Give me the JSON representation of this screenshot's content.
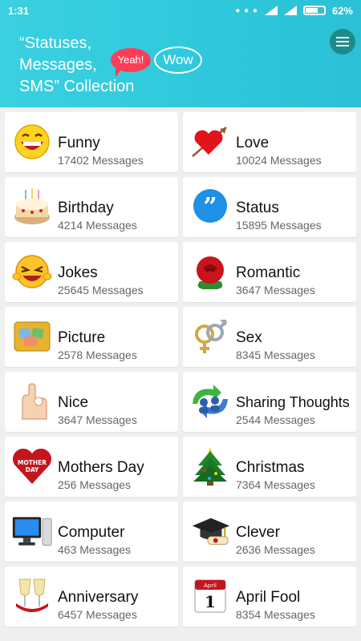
{
  "status_bar": {
    "time": "1:31",
    "battery": "62%"
  },
  "header": {
    "title_lines": [
      "“Statuses,",
      "Messages,",
      "SMS” Collection"
    ],
    "bubble_yeah": "Yeah!",
    "bubble_wow": "Wow"
  },
  "categories": [
    {
      "name": "Funny",
      "count": "17402 Messages",
      "icon": "laughing-smiley-icon"
    },
    {
      "name": "Love",
      "count": "10024 Messages",
      "icon": "heart-arrow-icon"
    },
    {
      "name": "Birthday",
      "count": "4214 Messages",
      "icon": "birthday-cake-icon"
    },
    {
      "name": "Status",
      "count": "15895 Messages",
      "icon": "quote-bubble-icon"
    },
    {
      "name": "Jokes",
      "count": "25645 Messages",
      "icon": "laughing-face-icon"
    },
    {
      "name": "Romantic",
      "count": "3647 Messages",
      "icon": "rose-icon"
    },
    {
      "name": "Picture",
      "count": "2578 Messages",
      "icon": "photo-folder-icon"
    },
    {
      "name": "Sex",
      "count": "8345 Messages",
      "icon": "gender-symbols-icon"
    },
    {
      "name": "Nice",
      "count": "3647 Messages",
      "icon": "ok-hand-icon"
    },
    {
      "name": "Sharing Thoughts",
      "count": "2544 Messages",
      "icon": "users-sync-icon"
    },
    {
      "name": "Mothers Day",
      "count": "256 Messages",
      "icon": "mothers-day-heart-icon"
    },
    {
      "name": "Christmas",
      "count": "7364 Messages",
      "icon": "christmas-tree-icon"
    },
    {
      "name": "Computer",
      "count": "463 Messages",
      "icon": "desktop-computer-icon"
    },
    {
      "name": "Clever",
      "count": "2636 Messages",
      "icon": "graduation-cap-icon"
    },
    {
      "name": "Anniversary",
      "count": "6457 Messages",
      "icon": "champagne-glasses-icon"
    },
    {
      "name": "April Fool",
      "count": "8354 Messages",
      "icon": "calendar-april-icon"
    }
  ],
  "calendar_icon_text": {
    "month": "April",
    "day": "1"
  },
  "mothers_day_icon_text": {
    "line1": "MOTHER",
    "line2": "DAY"
  }
}
